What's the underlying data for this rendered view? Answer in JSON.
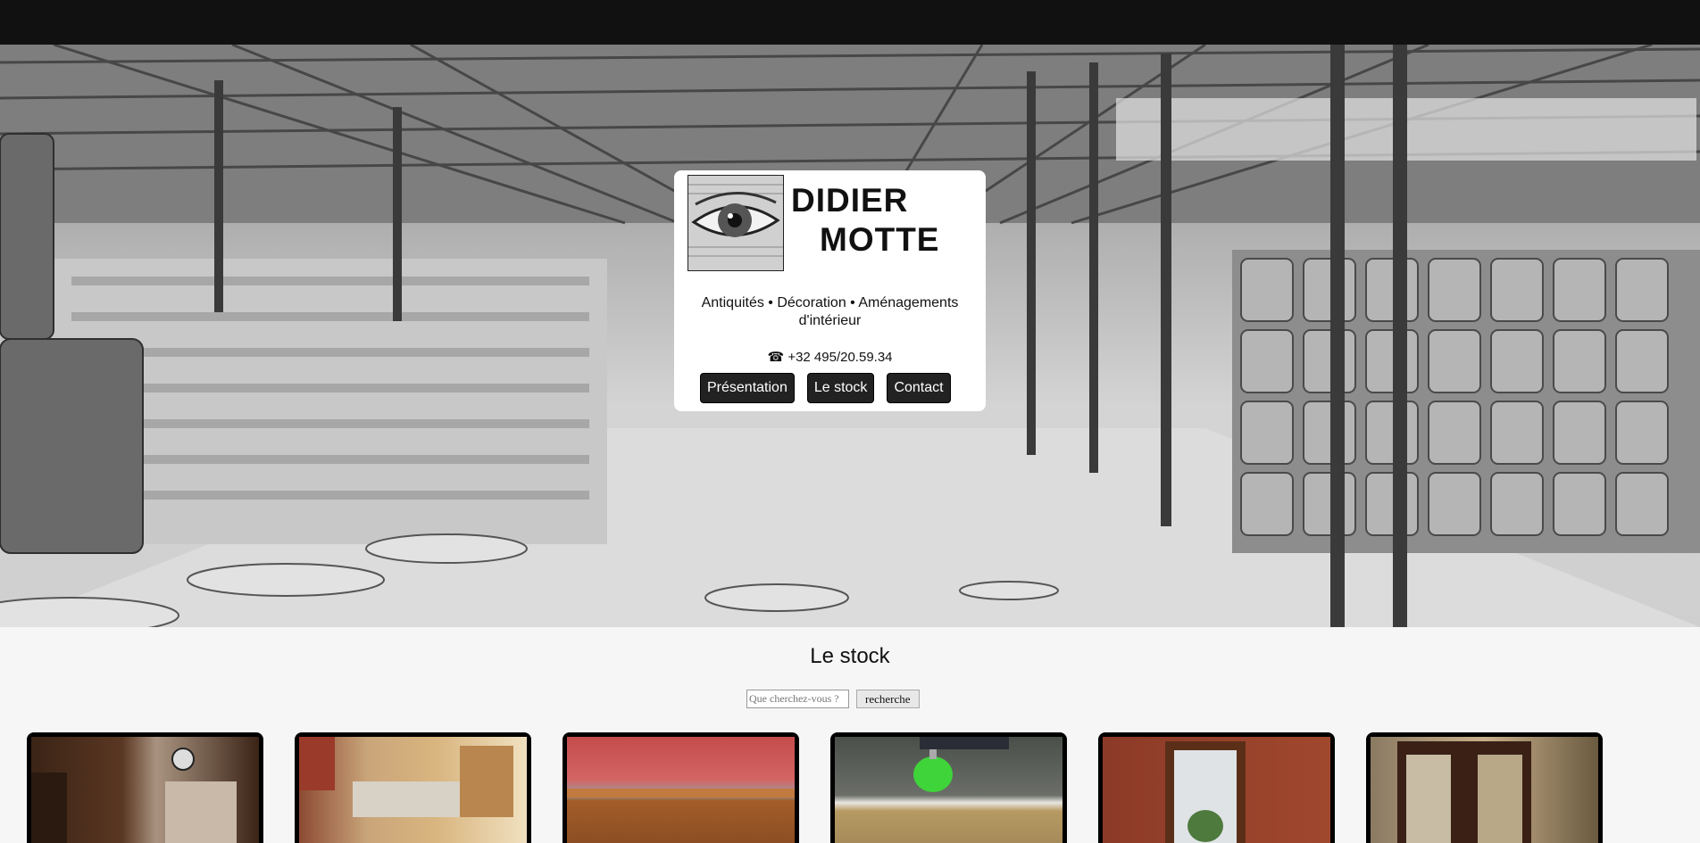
{
  "header": {
    "brand_line1": "DIDIER",
    "brand_line2": "MOTTE",
    "tagline": "Antiquités • Décoration • Aménagements d'intérieur",
    "phone": "☎ +32 495/20.59.34",
    "nav": [
      {
        "label": "Présentation"
      },
      {
        "label": "Le stock"
      },
      {
        "label": "Contact"
      }
    ]
  },
  "stock": {
    "title": "Le stock",
    "search": {
      "placeholder": "Que cherchez-vous ?",
      "button": "recherche"
    },
    "items": [
      {
        "subject": "carved wooden cabinet with clock"
      },
      {
        "subject": "shop interior with shelves"
      },
      {
        "subject": "wooden counter against brick wall"
      },
      {
        "subject": "marble-top sideboard with green vase"
      },
      {
        "subject": "tall mirror against brick wall"
      },
      {
        "subject": "dark wood mirrored wardrobe"
      }
    ]
  },
  "colors": {
    "topbar": "#111111",
    "button": "#222222",
    "page": "#f6f6f6"
  }
}
